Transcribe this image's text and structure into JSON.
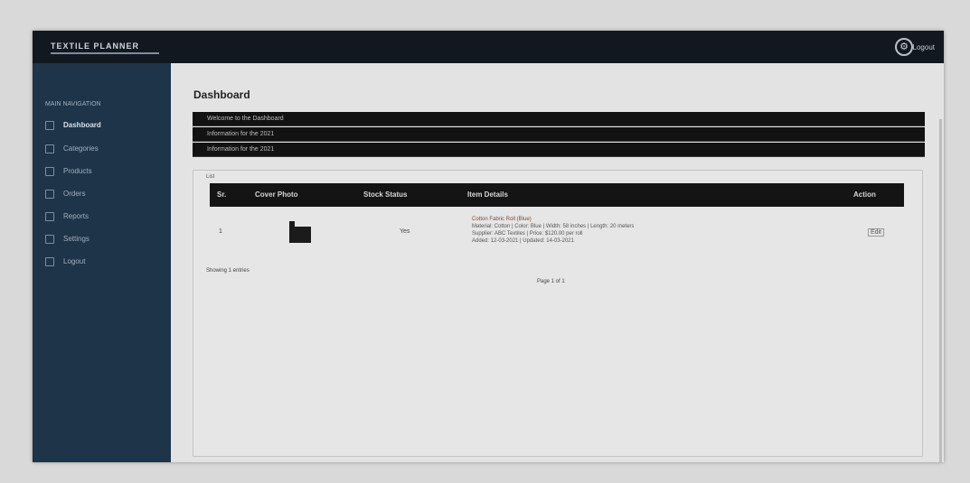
{
  "app": {
    "logo": "TEXTILE PLANNER",
    "user_label": "Logout"
  },
  "sidebar": {
    "heading": "MAIN NAVIGATION",
    "items": [
      {
        "label": "Dashboard",
        "icon": "square-icon",
        "active": true
      },
      {
        "label": "Categories",
        "icon": "square-icon",
        "active": false
      },
      {
        "label": "Products",
        "icon": "square-icon",
        "active": false
      },
      {
        "label": "Orders",
        "icon": "square-icon",
        "active": false
      },
      {
        "label": "Reports",
        "icon": "square-icon",
        "active": false
      },
      {
        "label": "Settings",
        "icon": "square-icon",
        "active": false
      },
      {
        "label": "Logout",
        "icon": "square-icon",
        "active": false
      }
    ]
  },
  "main": {
    "title": "Dashboard",
    "accordions": [
      "Welcome to the Dashboard",
      "Information for the 2021",
      "Information for the 2021"
    ],
    "panel_label": "List",
    "table": {
      "headers": [
        "Sr.",
        "Cover Photo",
        "Stock Status",
        "Item Details",
        "Action"
      ],
      "rows": [
        {
          "sr": "1",
          "status": "Yes",
          "details_line1": "Cotton Fabric Roll (Blue)",
          "details_line2": "Material: Cotton | Color: Blue | Width: 58 inches | Length: 20 meters",
          "details_line3": "Supplier: ABC Textiles | Price: $120.00 per roll",
          "details_line4": "Added: 12-03-2021 | Updated: 14-03-2021",
          "action": "Edit"
        }
      ]
    },
    "showing_text": "Showing 1 entries",
    "pagination": "Page 1 of 1"
  }
}
